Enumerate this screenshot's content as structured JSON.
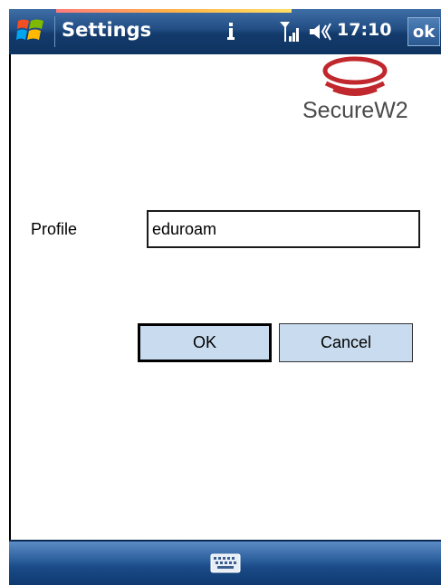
{
  "titlebar": {
    "title": "Settings",
    "time": "17:10",
    "ok_label": "ok",
    "icons": [
      "windows-start-icon",
      "info-icon",
      "signal-icon",
      "speaker-icon"
    ]
  },
  "logo": {
    "text": "SecureW2",
    "color": "#c0282d"
  },
  "form": {
    "profile_label": "Profile",
    "profile_value": "eduroam"
  },
  "buttons": {
    "ok_label": "OK",
    "cancel_label": "Cancel"
  },
  "bottombar": {
    "icons": [
      "keyboard-icon"
    ]
  },
  "colors": {
    "title_bar": "#214d83",
    "button_face": "#c9dcef"
  }
}
